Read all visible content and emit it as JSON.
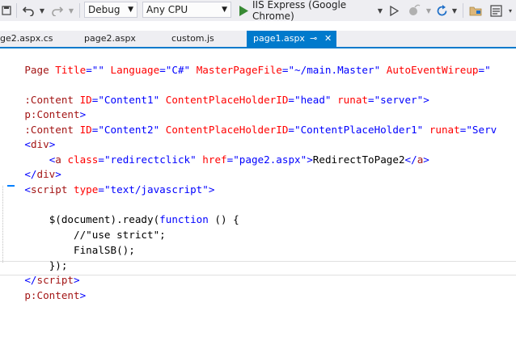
{
  "toolbar": {
    "config_value": "Debug",
    "platform_value": "Any CPU",
    "run_label": "IIS Express (Google Chrome)",
    "colors": {
      "play": "#388a34",
      "accent": "#007acc",
      "file_icon": "#dcb67a"
    }
  },
  "tabs": [
    {
      "label": "ge2.aspx.cs"
    },
    {
      "label": "page2.aspx"
    },
    {
      "label": "custom.js"
    },
    {
      "label": "page1.aspx",
      "active": true
    }
  ],
  "code": {
    "l1": {
      "t1": "Page ",
      "a1": "Title",
      "v1": "=\"\" ",
      "a2": "Language",
      "v2": "=\"C#\" ",
      "a3": "MasterPageFile",
      "v3": "=\"~/main.Master\" ",
      "a4": "AutoEventWireup",
      "v4": "=\""
    },
    "l3": {
      "t1": ":Content ",
      "a1": "ID",
      "v1": "=\"Content1\" ",
      "a2": "ContentPlaceHolderID",
      "v2": "=\"head\" ",
      "a3": "runat",
      "v3": "=\"server\">"
    },
    "l4": {
      "t1": "p:Content",
      "v1": ">"
    },
    "l5": {
      "t1": ":Content ",
      "a1": "ID",
      "v1": "=\"Content2\" ",
      "a2": "ContentPlaceHolderID",
      "v2": "=\"ContentPlaceHolder1\" ",
      "a3": "runat",
      "v3": "=\"Serv"
    },
    "l6": {
      "d1": "<",
      "n1": "div",
      "d2": ">"
    },
    "l7": {
      "indent": "    ",
      "d1": "<",
      "n1": "a ",
      "a1": "class",
      "v1": "=\"redirectclick\" ",
      "a2": "href",
      "v2": "=\"page2.aspx\"",
      "d2": ">",
      "t1": "RedirectToPage2",
      "d3": "</",
      "n2": "a",
      "d4": ">"
    },
    "l8": {
      "d1": "</",
      "n1": "div",
      "d2": ">"
    },
    "l9": {
      "d1": "<",
      "n1": "script ",
      "a1": "type",
      "v1": "=\"text/javascript\"",
      "d2": ">"
    },
    "l11": {
      "indent": "    ",
      "t1": "$(document).ready(",
      "k1": "function",
      "t2": " () {"
    },
    "l12": {
      "indent": "        ",
      "t1": "//\"use strict\";"
    },
    "l13": {
      "indent": "        ",
      "t1": "FinalSB();"
    },
    "l14": {
      "indent": "    ",
      "t1": "});"
    },
    "l15": {
      "d1": "</",
      "n1": "script",
      "d2": ">"
    },
    "l16": {
      "t1": "p:Content",
      "v1": ">"
    }
  }
}
